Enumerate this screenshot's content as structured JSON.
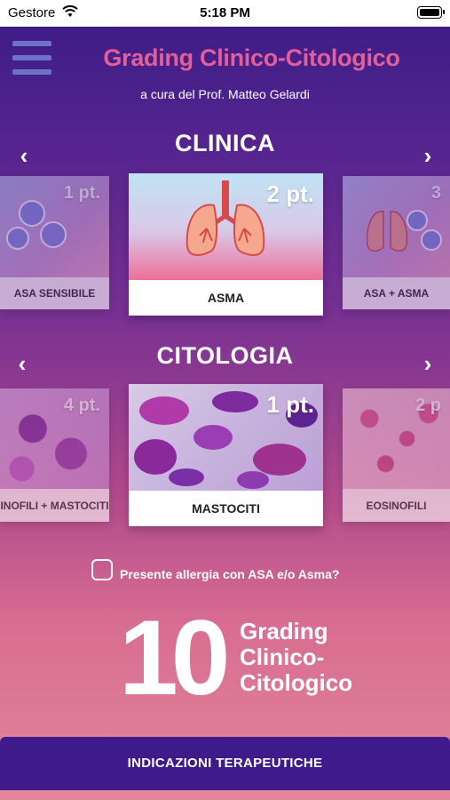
{
  "status_bar": {
    "carrier": "Gestore",
    "time": "5:18 PM"
  },
  "header": {
    "title": "Grading Clinico-Citologico",
    "subtitle": "a cura del Prof. Matteo Gelardi"
  },
  "clinica": {
    "title": "CLINICA",
    "left": {
      "label": "ASA SENSIBILE",
      "points": "1 pt."
    },
    "center": {
      "label": "ASMA",
      "points": "2 pt."
    },
    "right": {
      "label": "ASA + ASMA",
      "points": "3"
    }
  },
  "citologia": {
    "title": "CITOLOGIA",
    "left": {
      "label": "INOFILI + MASTOCITI",
      "points": "4 pt."
    },
    "center": {
      "label": "MASTOCITI",
      "points": "1 pt."
    },
    "right": {
      "label": "EOSINOFILI",
      "points": "2 p"
    }
  },
  "allergy_check": {
    "label": "Presente allergia con ASA e/o Asma?",
    "checked": false
  },
  "grade": {
    "value": "10",
    "line1": "Grading",
    "line2": "Clinico-",
    "line3": "Citologico"
  },
  "cta": {
    "label": "INDICAZIONI TERAPEUTICHE"
  },
  "icons": {
    "menu": "hamburger-icon",
    "prev": "chevron-left-icon",
    "next": "chevron-right-icon"
  },
  "colors": {
    "title": "#e35f98",
    "button": "#3e1a8a"
  }
}
